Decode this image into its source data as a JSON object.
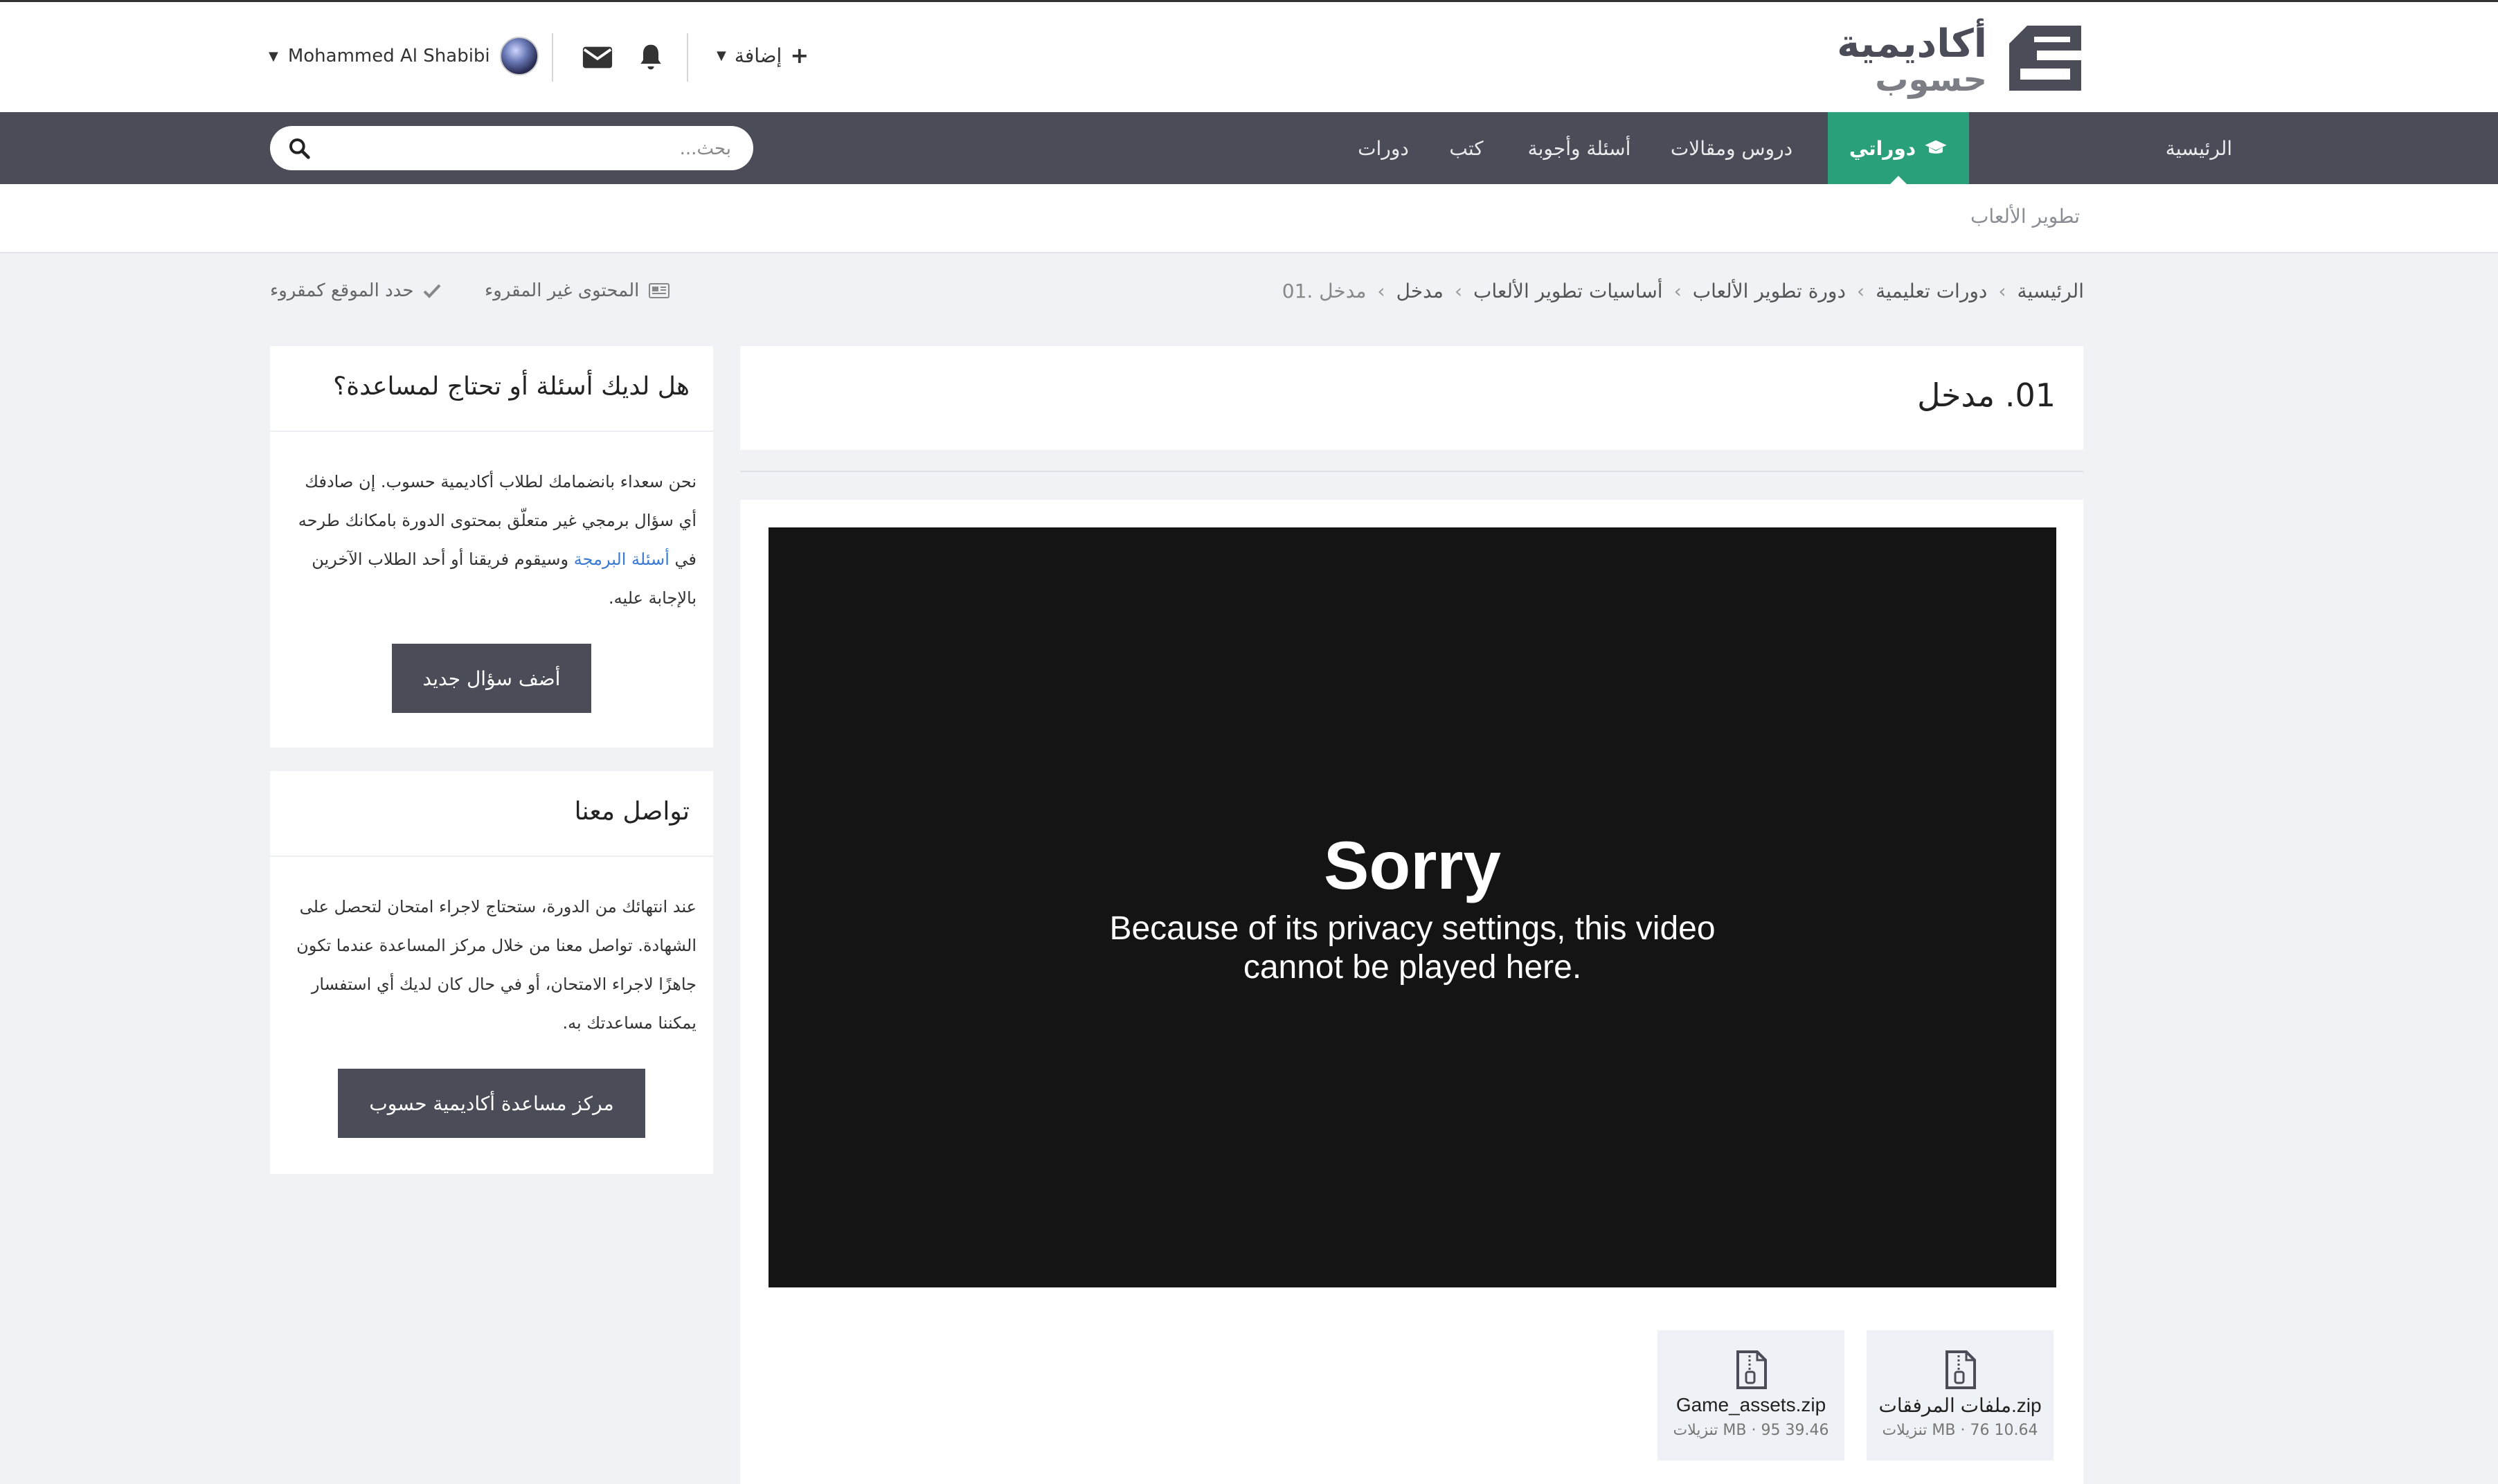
{
  "brand": {
    "line1": "أكاديمية",
    "line2": "حسوب"
  },
  "header": {
    "add_label": "إضافة",
    "user_name": "Mohammed Al Shabibi"
  },
  "nav": {
    "items": [
      {
        "label": "الرئيسية"
      },
      {
        "label": "دوراتي"
      },
      {
        "label": "دروس ومقالات"
      },
      {
        "label": "أسئلة وأجوبة"
      },
      {
        "label": "كتب"
      },
      {
        "label": "دورات"
      }
    ],
    "active_color": "#2aa07a",
    "bar_color": "#4a4d57"
  },
  "search": {
    "placeholder": "بحث..."
  },
  "subnav": {
    "item": "تطوير الألعاب"
  },
  "breadcrumb": [
    "الرئيسية",
    "دورات تعليمية",
    "دورة تطوير الألعاب",
    "أساسيات تطوير الألعاب",
    "مدخل",
    "01. مدخل"
  ],
  "actions": {
    "unread": "المحتوى غير المقروء",
    "mark_read": "حدد الموقع كمقروء"
  },
  "lesson": {
    "title": "01. مدخل"
  },
  "video": {
    "title": "Sorry",
    "message_line1": "Because of its privacy settings, this video",
    "message_line2": "cannot be played here."
  },
  "attachments": [
    {
      "name": "ملفات المرفقات.zip",
      "meta": "10.64 MB · 76 تنزيلات"
    },
    {
      "name": "Game_assets.zip",
      "meta": "39.46 MB · 95 تنزيلات"
    }
  ],
  "help_card": {
    "title": "هل لديك أسئلة أو تحتاج لمساعدة؟",
    "text_before": "نحن سعداء بانضمامك لطلاب أكاديمية حسوب. إن صادفك أي سؤال برمجي غير متعلّق بمحتوى الدورة بامكانك طرحه في ",
    "link": "أسئلة البرمجة",
    "text_after": " وسيقوم فريقنا أو أحد الطلاب الآخرين بالإجابة عليه.",
    "button": "أضف سؤال جديد"
  },
  "contact_card": {
    "title": "تواصل معنا",
    "text": "عند انتهائك من الدورة، ستحتاج لاجراء امتحان لتحصل على الشهادة. تواصل معنا من خلال مركز المساعدة عندما تكون جاهزًا لاجراء الامتحان، أو في حال كان لديك أي استفسار يمكننا مساعدتك به.",
    "button": "مركز مساعدة أكاديمية حسوب"
  }
}
